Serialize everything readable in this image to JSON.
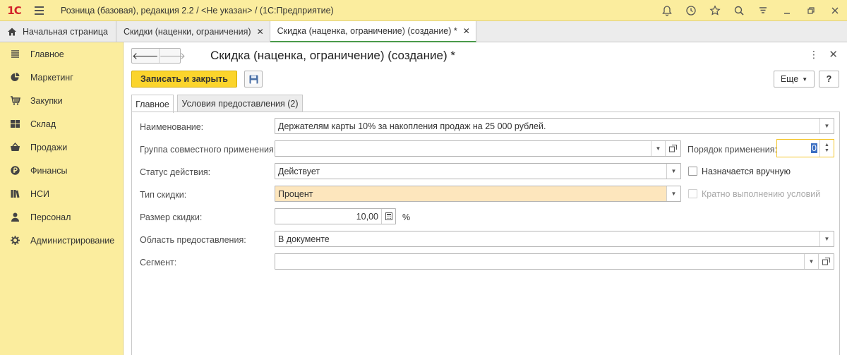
{
  "titlebar": {
    "logo": "1С",
    "title": "Розница (базовая), редакция 2.2 / <Не указан> /  (1С:Предприятие)"
  },
  "tabs": {
    "home": "Начальная страница",
    "items": [
      {
        "label": "Скидки (наценки, ограничения)"
      },
      {
        "label": "Скидка (наценка, ограничение) (создание) *"
      }
    ]
  },
  "sidebar": {
    "items": [
      {
        "label": "Главное",
        "icon": "menu-lines-icon"
      },
      {
        "label": "Маркетинг",
        "icon": "pie-chart-icon"
      },
      {
        "label": "Закупки",
        "icon": "cart-icon"
      },
      {
        "label": "Склад",
        "icon": "grid-icon"
      },
      {
        "label": "Продажи",
        "icon": "basket-icon"
      },
      {
        "label": "Финансы",
        "icon": "coin-icon"
      },
      {
        "label": "НСИ",
        "icon": "books-icon"
      },
      {
        "label": "Персонал",
        "icon": "person-icon"
      },
      {
        "label": "Администрирование",
        "icon": "gear-icon"
      }
    ]
  },
  "form": {
    "title": "Скидка (наценка, ограничение) (создание) *",
    "save_close": "Записать и закрыть",
    "more": "Еще",
    "help": "?",
    "tabs": [
      "Главное",
      "Условия предоставления (2)"
    ],
    "fields": {
      "name_label": "Наименование:",
      "name_value": "Держателям карты 10% за накопления продаж на 25 000 рублей.",
      "group_label": "Группа совместного применения:",
      "group_value": "",
      "order_label": "Порядок применения:",
      "order_value": "0",
      "status_label": "Статус действия:",
      "status_value": "Действует",
      "manual_label": "Назначается вручную",
      "type_label": "Тип скидки:",
      "type_value": "Процент",
      "multiple_label": "Кратно выполнению условий",
      "size_label": "Размер скидки:",
      "size_value": "10,00",
      "size_unit": "%",
      "area_label": "Область предоставления:",
      "area_value": "В документе",
      "segment_label": "Сегмент:",
      "segment_value": ""
    }
  },
  "colors": {
    "panel": "#fbed9e",
    "accent_button": "#fbd42c",
    "highlight_field": "#fde6bd",
    "active_tab_line": "#4a9a4a"
  }
}
